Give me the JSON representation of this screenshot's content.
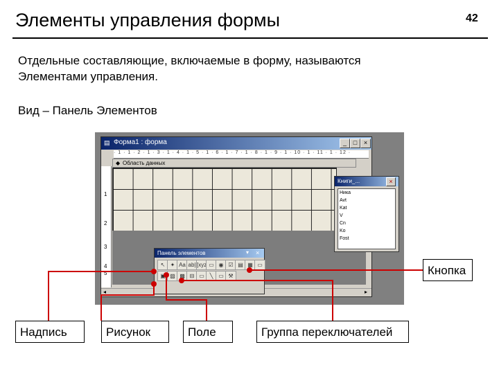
{
  "slide": {
    "title": "Элементы управления формы",
    "page_number": "42",
    "paragraph_line1": "Отдельные составляющие, включаемые в форму, называются",
    "paragraph_line2": "Элементами управления.",
    "view_line": "Вид – Панель Элементов"
  },
  "screenshot": {
    "window_title": "Форма1 : форма",
    "ruler_text": "· 1 · 1 · 2 · 1 · 3 · 1 · 4 · 1 · 5 · 1 · 6 · 1 · 7 · 1 · 8 · 1 · 9 · 1 · 10 · 1 · 11 · 1 · 12 ·",
    "section_label": "Область данных",
    "vertical_ruler": [
      "1",
      "2",
      "3",
      "4",
      "5"
    ],
    "field_list": {
      "title": "Книги_...",
      "items": [
        "Ника",
        "Avt",
        "Kat",
        "V",
        "Cn",
        "Ko",
        "Fost"
      ]
    },
    "toolbox": {
      "title": "Панель элементов",
      "close": "×",
      "row1": [
        "↖",
        "✦",
        "Aa",
        "ab|",
        "[xyz]",
        "▭",
        "◉",
        "☑",
        "▤",
        "▦",
        "▭"
      ],
      "row2": [
        "▣",
        "▨",
        "▩",
        "⊟",
        "▭",
        "╲",
        "▭",
        "⚒"
      ]
    },
    "window_buttons": [
      "_",
      "□",
      "×"
    ]
  },
  "callouts": {
    "button": "Кнопка",
    "label": "Надпись",
    "picture": "Рисунок",
    "field": "Поле",
    "option_group": "Группа переключателей",
    "line_color": "#cc0000"
  }
}
